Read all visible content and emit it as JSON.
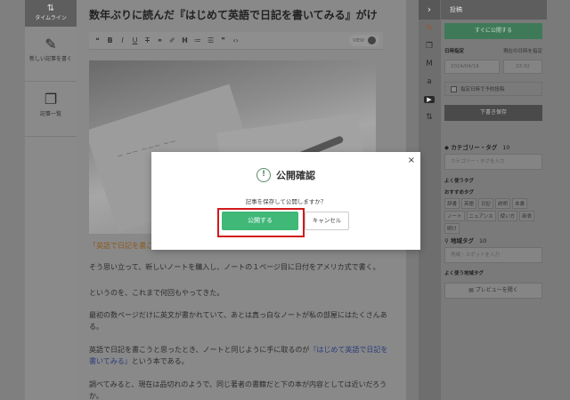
{
  "left_sidebar": {
    "timeline_label": "タイムライン",
    "new_post_label": "新しい記事を書く",
    "post_list_label": "記事一覧"
  },
  "editor": {
    "title": "数年ぶりに読んだ『はじめて英語で日記を書いてみる』がけ",
    "toolbar": {
      "bold": "B",
      "italic": "I",
      "underline": "U",
      "strike": "T",
      "heading": "H",
      "view_label": "VIEW"
    },
    "quote_line": "「英語で日記を書こ",
    "paragraphs": [
      "そう思い立って、新しいノートを購入し、ノートの１ページ目に日付をアメリカ式で書く。",
      "というのを、これまで何回もやってきた。",
      "最初の数ページだけに英文が書かれていて、あとは真っ白なノートが私の部屋にはたくさんある。",
      "英語で日記を書こうと思ったとき、ノートと同じように手に取るのが",
      "という本である。",
      "調べてみると、現在は品切れのようで、同じ著者の書籍だと下の本が内容としては近いだろうか。"
    ],
    "book_link": "『はじめて英語で日記を書いてみる』"
  },
  "right_panel": {
    "header": "投稿",
    "publish_now": "すぐに公開する",
    "schedule_label": "日時指定",
    "schedule_reset": "現在の日時を指定",
    "date_value": "2024/04/18",
    "time_value": "23:32",
    "schedule_checkbox_label": "指定日時で予約投稿",
    "save_draft": "下書き保存",
    "category_heading": "カテゴリー・タグ",
    "category_count": "10",
    "category_placeholder": "カテゴリー・タグを入力",
    "frequent_tags_label": "よく使うタグ",
    "recommended_tags_label": "おすすめタグ",
    "tags": [
      "辞書",
      "英語",
      "日記",
      "説明",
      "本書",
      "ノート",
      "ニュアンス",
      "使い方",
      "新表",
      "明け"
    ],
    "location_heading": "地域タグ",
    "location_count": "10",
    "location_placeholder": "地域・スポットを入力",
    "frequent_location_label": "よく使う地域タグ",
    "preview_button": "プレビューを開く"
  },
  "modal": {
    "title": "公開確認",
    "message": "記事を保存して公開しますか？",
    "confirm_label": "公開する",
    "cancel_label": "キャンセル",
    "close_glyph": "×",
    "accent_color": "#3fb878",
    "highlight_color": "#d11a1a"
  }
}
